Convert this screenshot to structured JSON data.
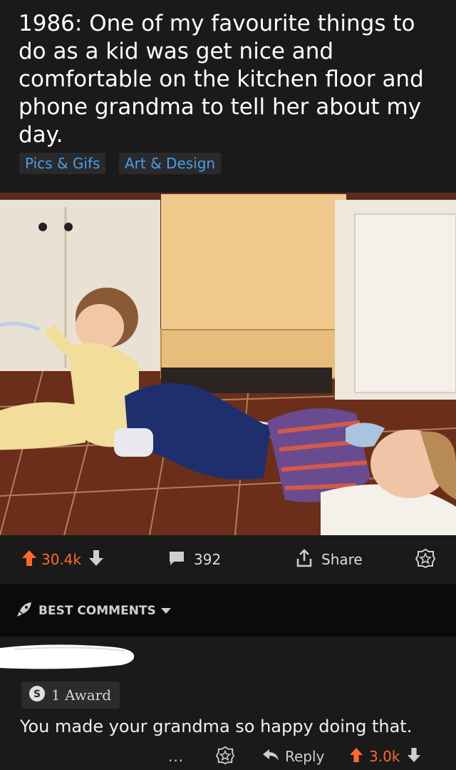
{
  "post": {
    "title": "1986: One of my favourite things to do as a kid was get nice and comfortable on the kitchen floor and phone grandma to tell her about my day.",
    "flairs": [
      "Pics & Gifs",
      "Art & Design"
    ]
  },
  "actions": {
    "upvotes": "30.4k",
    "comments": "392",
    "share_label": "Share"
  },
  "comments_sort": {
    "label": "BEST COMMENTS"
  },
  "comment": {
    "award_label": "1 Award",
    "body": "You made your grandma so happy doing that.",
    "more": "...",
    "reply_label": "Reply",
    "score": "3.0k"
  },
  "colors": {
    "background": "#1a1a1b",
    "upvote_accent": "#ff6a2c",
    "flair_text": "#4a9de8"
  },
  "icons": {
    "upvote": "arrow-up-icon",
    "downvote": "arrow-down-icon",
    "comments": "speech-bubble-icon",
    "share": "share-icon",
    "award": "award-icon",
    "sort": "rocket-icon",
    "reply": "reply-arrow-icon"
  }
}
